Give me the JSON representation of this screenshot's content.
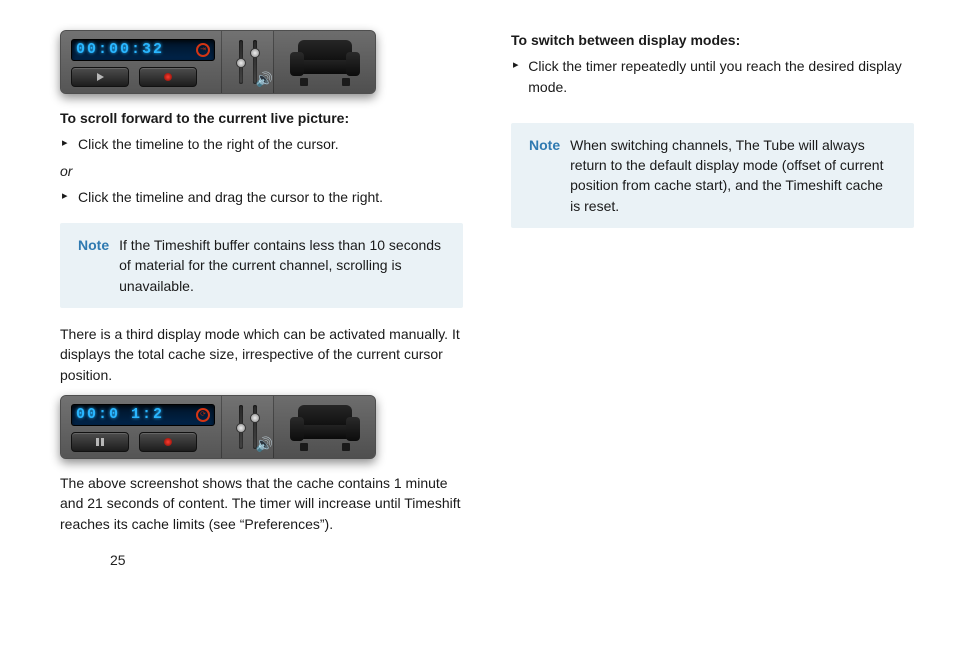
{
  "player1": {
    "time": "00:00:32",
    "button1_mode": "play"
  },
  "player2": {
    "time": "00:0 1:2",
    "button1_mode": "pause"
  },
  "left": {
    "heading1": "To scroll forward to the current live picture:",
    "bullet1": "Click the timeline to the right of the cursor.",
    "or": "or",
    "bullet2": "Click the timeline and drag the cursor to the right.",
    "note1_label": "Note",
    "note1_text": "If the Timeshift buffer contains less than 10 seconds of material for the current channel, scrolling is unavailable.",
    "para1": "There is a third display mode which can be activated manually. It displays the total cache size, irrespective of the current cursor position.",
    "para2": "The above screenshot shows that the cache contains 1 minute and 21 seconds of content. The timer will increase until Timeshift reaches its cache limits (see “Preferences”).",
    "pagenum": "25"
  },
  "right": {
    "heading1": "To switch between display modes:",
    "bullet1": "Click the timer repeatedly until you reach the desired display mode.",
    "note1_label": "Note",
    "note1_text": "When switching channels, The Tube will always return to the default display mode (offset of current position from cache start), and the Timeshift cache is reset."
  }
}
